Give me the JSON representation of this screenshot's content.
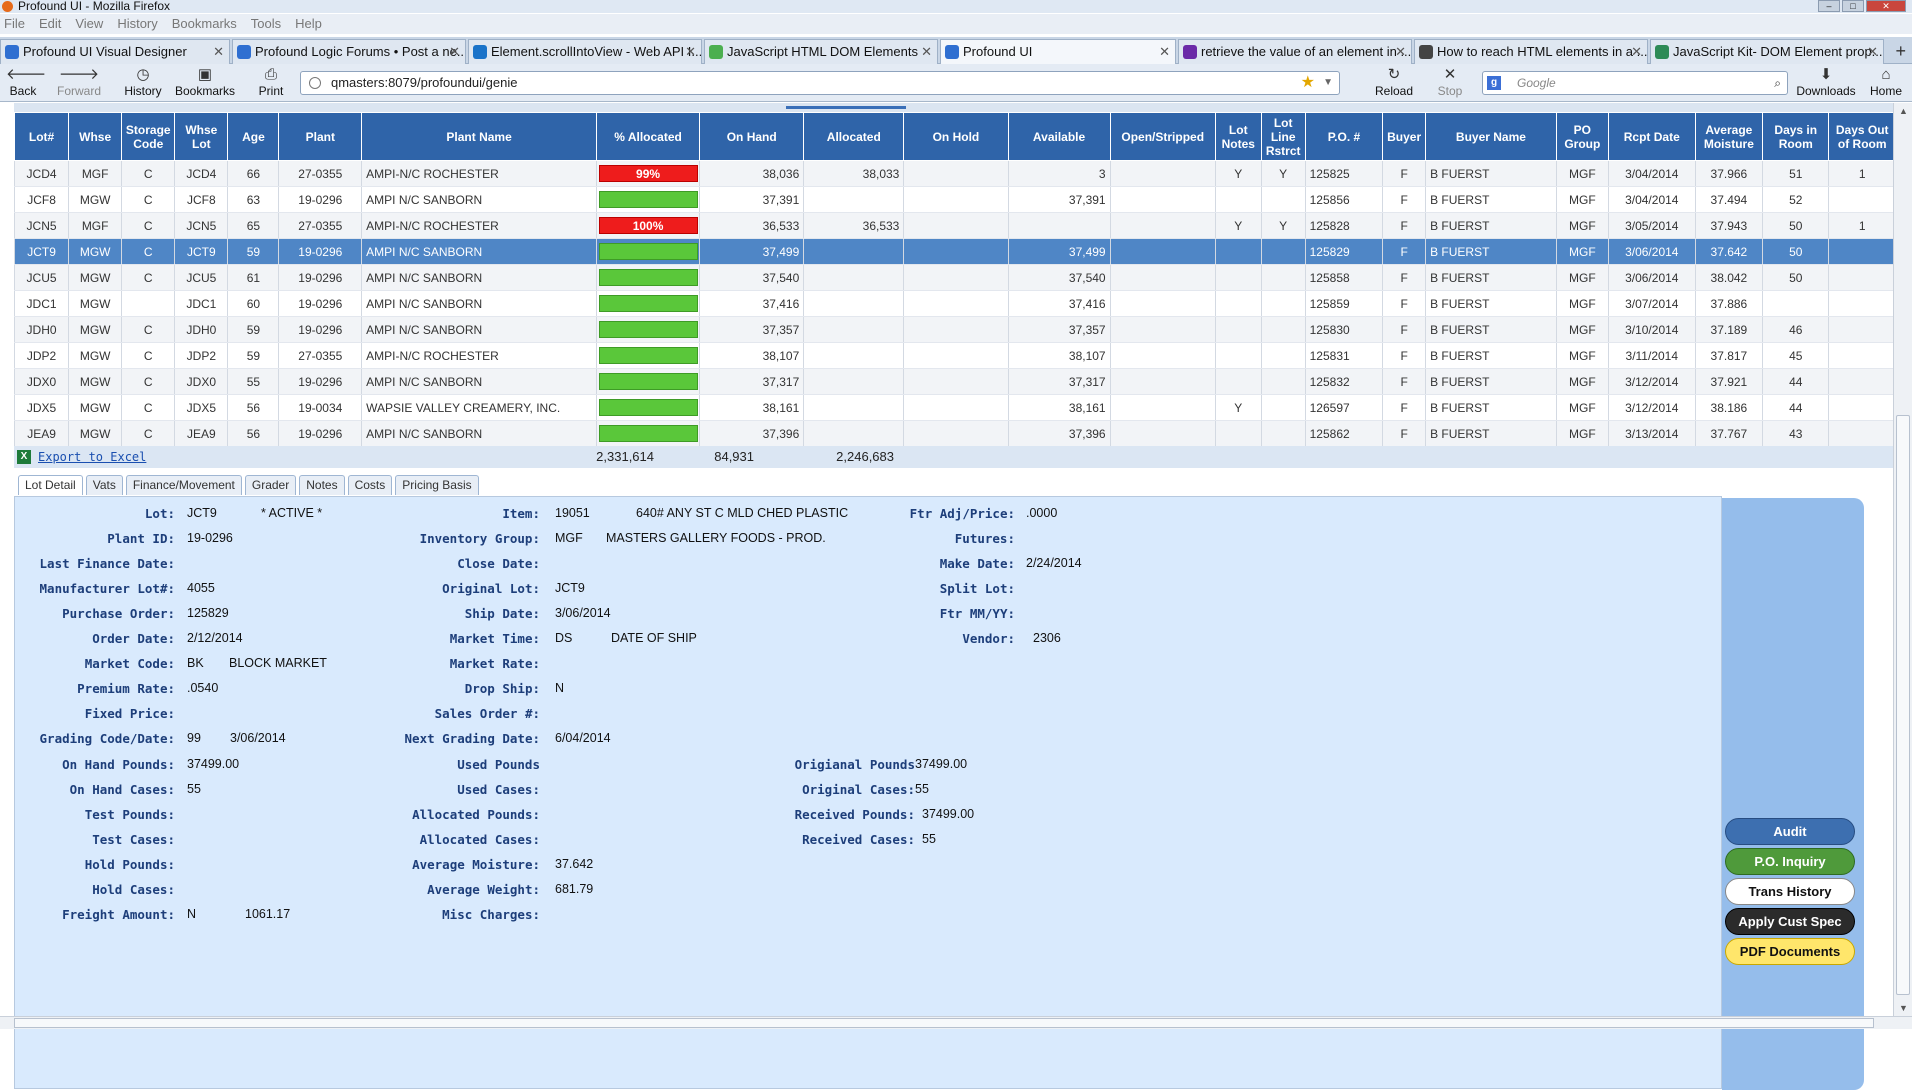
{
  "window": {
    "title": "Profound UI - Mozilla Firefox"
  },
  "menu": [
    "File",
    "Edit",
    "View",
    "History",
    "Bookmarks",
    "Tools",
    "Help"
  ],
  "tabs": [
    {
      "label": "Profound UI Visual Designer",
      "active": false,
      "icon_color": "#2f6fd1"
    },
    {
      "label": "Profound Logic Forums • Post a ne...",
      "active": false,
      "icon_color": "#2f6fd1"
    },
    {
      "label": "Element.scrollIntoView - Web API I...",
      "active": false,
      "icon_color": "#1a73c9"
    },
    {
      "label": "JavaScript HTML DOM Elements",
      "active": false,
      "icon_color": "#4caf50"
    },
    {
      "label": "Profound UI",
      "active": true,
      "icon_color": "#2f6fd1"
    },
    {
      "label": "retrieve the value of an element in ...",
      "active": false,
      "icon_color": "#6b2aa8"
    },
    {
      "label": "How to reach HTML elements in a ...",
      "active": false,
      "icon_color": "#444444"
    },
    {
      "label": "JavaScript Kit- DOM Element prop...",
      "active": false,
      "icon_color": "#2e8b57"
    }
  ],
  "nav": {
    "back": "Back",
    "forward": "Forward",
    "history": "History",
    "bookmarks": "Bookmarks",
    "print": "Print",
    "url": "qmasters:8079/profoundui/genie",
    "reload": "Reload",
    "stop": "Stop",
    "search_placeholder": "Google",
    "downloads": "Downloads",
    "home": "Home"
  },
  "grid": {
    "columns": [
      "Lot#",
      "Whse",
      "Storage Code",
      "Whse Lot",
      "Age",
      "Plant",
      "Plant Name",
      "% Allocated",
      "On Hand",
      "Allocated",
      "On Hold",
      "Available",
      "Open/Stripped",
      "Lot Notes",
      "Lot Line Rstrct",
      "P.O. #",
      "Buyer",
      "Buyer Name",
      "PO Group",
      "Rcpt Date",
      "Average Moisture",
      "Days in Room",
      "Days Out of Room"
    ],
    "rows": [
      {
        "lot": "JCD4",
        "whse": "MGF",
        "storage": "C",
        "whse_lot": "JCD4",
        "age": "66",
        "plant": "27-0355",
        "plant_name": "AMPI-N/C ROCHESTER",
        "pct_label": "99%",
        "pct": 0.99,
        "bar": "red",
        "on_hand": "38,036",
        "allocated": "38,033",
        "on_hold": "",
        "available": "3",
        "open": "",
        "notes": "Y",
        "rstrct": "Y",
        "po": "125825",
        "buyer": "F",
        "buyer_name": "B FUERST",
        "po_group": "MGF",
        "rcpt": "3/04/2014",
        "moist": "37.966",
        "days_in": "51",
        "days_out": "1"
      },
      {
        "lot": "JCF8",
        "whse": "MGW",
        "storage": "C",
        "whse_lot": "JCF8",
        "age": "63",
        "plant": "19-0296",
        "plant_name": "AMPI N/C SANBORN",
        "pct_label": "",
        "pct": 0,
        "bar": "green",
        "on_hand": "37,391",
        "allocated": "",
        "on_hold": "",
        "available": "37,391",
        "open": "",
        "notes": "",
        "rstrct": "",
        "po": "125856",
        "buyer": "F",
        "buyer_name": "B FUERST",
        "po_group": "MGF",
        "rcpt": "3/04/2014",
        "moist": "37.494",
        "days_in": "52",
        "days_out": ""
      },
      {
        "lot": "JCN5",
        "whse": "MGF",
        "storage": "C",
        "whse_lot": "JCN5",
        "age": "65",
        "plant": "27-0355",
        "plant_name": "AMPI-N/C ROCHESTER",
        "pct_label": "100%",
        "pct": 1.0,
        "bar": "red",
        "on_hand": "36,533",
        "allocated": "36,533",
        "on_hold": "",
        "available": "",
        "open": "",
        "notes": "Y",
        "rstrct": "Y",
        "po": "125828",
        "buyer": "F",
        "buyer_name": "B FUERST",
        "po_group": "MGF",
        "rcpt": "3/05/2014",
        "moist": "37.943",
        "days_in": "50",
        "days_out": "1"
      },
      {
        "lot": "JCT9",
        "whse": "MGW",
        "storage": "C",
        "whse_lot": "JCT9",
        "age": "59",
        "plant": "19-0296",
        "plant_name": "AMPI N/C SANBORN",
        "pct_label": "",
        "pct": 0,
        "bar": "green",
        "on_hand": "37,499",
        "allocated": "",
        "on_hold": "",
        "available": "37,499",
        "open": "",
        "notes": "",
        "rstrct": "",
        "po": "125829",
        "buyer": "F",
        "buyer_name": "B FUERST",
        "po_group": "MGF",
        "rcpt": "3/06/2014",
        "moist": "37.642",
        "days_in": "50",
        "days_out": "",
        "selected": true
      },
      {
        "lot": "JCU5",
        "whse": "MGW",
        "storage": "C",
        "whse_lot": "JCU5",
        "age": "61",
        "plant": "19-0296",
        "plant_name": "AMPI N/C SANBORN",
        "pct_label": "",
        "pct": 0,
        "bar": "green",
        "on_hand": "37,540",
        "allocated": "",
        "on_hold": "",
        "available": "37,540",
        "open": "",
        "notes": "",
        "rstrct": "",
        "po": "125858",
        "buyer": "F",
        "buyer_name": "B FUERST",
        "po_group": "MGF",
        "rcpt": "3/06/2014",
        "moist": "38.042",
        "days_in": "50",
        "days_out": ""
      },
      {
        "lot": "JDC1",
        "whse": "MGW",
        "storage": "",
        "whse_lot": "JDC1",
        "age": "60",
        "plant": "19-0296",
        "plant_name": "AMPI N/C SANBORN",
        "pct_label": "",
        "pct": 0,
        "bar": "green",
        "on_hand": "37,416",
        "allocated": "",
        "on_hold": "",
        "available": "37,416",
        "open": "",
        "notes": "",
        "rstrct": "",
        "po": "125859",
        "buyer": "F",
        "buyer_name": "B FUERST",
        "po_group": "MGF",
        "rcpt": "3/07/2014",
        "moist": "37.886",
        "days_in": "",
        "days_out": ""
      },
      {
        "lot": "JDH0",
        "whse": "MGW",
        "storage": "C",
        "whse_lot": "JDH0",
        "age": "59",
        "plant": "19-0296",
        "plant_name": "AMPI N/C SANBORN",
        "pct_label": "",
        "pct": 0,
        "bar": "green",
        "on_hand": "37,357",
        "allocated": "",
        "on_hold": "",
        "available": "37,357",
        "open": "",
        "notes": "",
        "rstrct": "",
        "po": "125830",
        "buyer": "F",
        "buyer_name": "B FUERST",
        "po_group": "MGF",
        "rcpt": "3/10/2014",
        "moist": "37.189",
        "days_in": "46",
        "days_out": ""
      },
      {
        "lot": "JDP2",
        "whse": "MGW",
        "storage": "C",
        "whse_lot": "JDP2",
        "age": "59",
        "plant": "27-0355",
        "plant_name": "AMPI-N/C ROCHESTER",
        "pct_label": "",
        "pct": 0,
        "bar": "green",
        "on_hand": "38,107",
        "allocated": "",
        "on_hold": "",
        "available": "38,107",
        "open": "",
        "notes": "",
        "rstrct": "",
        "po": "125831",
        "buyer": "F",
        "buyer_name": "B FUERST",
        "po_group": "MGF",
        "rcpt": "3/11/2014",
        "moist": "37.817",
        "days_in": "45",
        "days_out": ""
      },
      {
        "lot": "JDX0",
        "whse": "MGW",
        "storage": "C",
        "whse_lot": "JDX0",
        "age": "55",
        "plant": "19-0296",
        "plant_name": "AMPI N/C SANBORN",
        "pct_label": "",
        "pct": 0,
        "bar": "green",
        "on_hand": "37,317",
        "allocated": "",
        "on_hold": "",
        "available": "37,317",
        "open": "",
        "notes": "",
        "rstrct": "",
        "po": "125832",
        "buyer": "F",
        "buyer_name": "B FUERST",
        "po_group": "MGF",
        "rcpt": "3/12/2014",
        "moist": "37.921",
        "days_in": "44",
        "days_out": ""
      },
      {
        "lot": "JDX5",
        "whse": "MGW",
        "storage": "C",
        "whse_lot": "JDX5",
        "age": "56",
        "plant": "19-0034",
        "plant_name": "WAPSIE VALLEY CREAMERY, INC.",
        "pct_label": "",
        "pct": 0,
        "bar": "green",
        "on_hand": "38,161",
        "allocated": "",
        "on_hold": "",
        "available": "38,161",
        "open": "",
        "notes": "Y",
        "rstrct": "",
        "po": "126597",
        "buyer": "F",
        "buyer_name": "B FUERST",
        "po_group": "MGF",
        "rcpt": "3/12/2014",
        "moist": "38.186",
        "days_in": "44",
        "days_out": ""
      },
      {
        "lot": "JEA9",
        "whse": "MGW",
        "storage": "C",
        "whse_lot": "JEA9",
        "age": "56",
        "plant": "19-0296",
        "plant_name": "AMPI N/C SANBORN",
        "pct_label": "",
        "pct": 0,
        "bar": "green",
        "on_hand": "37,396",
        "allocated": "",
        "on_hold": "",
        "available": "37,396",
        "open": "",
        "notes": "",
        "rstrct": "",
        "po": "125862",
        "buyer": "F",
        "buyer_name": "B FUERST",
        "po_group": "MGF",
        "rcpt": "3/13/2014",
        "moist": "37.767",
        "days_in": "43",
        "days_out": ""
      }
    ],
    "export_label": "Export to Excel",
    "totals": {
      "on_hand": "2,331,614",
      "allocated": "84,931",
      "available": "2,246,683"
    }
  },
  "detail_tabs": [
    "Lot Detail",
    "Vats",
    "Finance/Movement",
    "Grader",
    "Notes",
    "Costs",
    "Pricing Basis"
  ],
  "detail": {
    "lot_lbl": "Lot:",
    "lot": "JCT9",
    "status": "* ACTIVE *",
    "plant_id_lbl": "Plant ID:",
    "plant_id": "19-0296",
    "last_fin_lbl": "Last Finance Date:",
    "mfr_lot_lbl": "Manufacturer Lot#:",
    "mfr_lot": "4055",
    "po_lbl": "Purchase Order:",
    "po": "125829",
    "order_date_lbl": "Order Date:",
    "order_date": "2/12/2014",
    "market_code_lbl": "Market Code:",
    "market_code": "BK",
    "market_desc": "BLOCK MARKET",
    "premium_lbl": "Premium Rate:",
    "premium": ".0540",
    "fixed_lbl": "Fixed Price:",
    "grading_lbl": "Grading Code/Date:",
    "grading_code": "99",
    "grading_date": "3/06/2014",
    "item_lbl": "Item:",
    "item": "19051",
    "item_desc": "640# ANY ST C MLD CHED PLASTIC",
    "inv_group_lbl": "Inventory Group:",
    "inv_group": "MGF",
    "inv_group_desc": "MASTERS GALLERY FOODS - PROD.",
    "close_lbl": "Close Date:",
    "orig_lot_lbl": "Original Lot:",
    "orig_lot": "JCT9",
    "ship_lbl": "Ship Date:",
    "ship": "3/06/2014",
    "mkt_time_lbl": "Market Time:",
    "mkt_time": "DS",
    "mkt_time_desc": "DATE OF SHIP",
    "mkt_rate_lbl": "Market Rate:",
    "drop_lbl": "Drop Ship:",
    "drop": "N",
    "sales_lbl": "Sales Order #:",
    "next_grade_lbl": "Next Grading Date:",
    "next_grade": "6/04/2014",
    "ftr_adj_lbl": "Ftr Adj/Price:",
    "ftr_adj": ".0000",
    "futures_lbl": "Futures:",
    "make_lbl": "Make Date:",
    "make": "2/24/2014",
    "split_lbl": "Split Lot:",
    "ftr_mm_lbl": "Ftr MM/YY:",
    "vendor_lbl": "Vendor:",
    "vendor": "2306",
    "on_hand_lb_lbl": "On Hand Pounds:",
    "on_hand_lb": "37499.00",
    "on_hand_cs_lbl": "On Hand Cases:",
    "on_hand_cs": "55",
    "test_lb_lbl": "Test Pounds:",
    "test_cs_lbl": "Test Cases:",
    "hold_lb_lbl": "Hold Pounds:",
    "hold_cs_lbl": "Hold Cases:",
    "freight_lbl": "Freight Amount:",
    "freight_flag": "N",
    "freight": "1061.17",
    "used_lb_lbl": "Used Pounds",
    "used_cs_lbl": "Used Cases:",
    "alloc_lb_lbl": "Allocated Pounds:",
    "alloc_cs_lbl": "Allocated Cases:",
    "avg_moist_lbl": "Average Moisture:",
    "avg_moist": "37.642",
    "avg_wt_lbl": "Average Weight:",
    "avg_wt": "681.79",
    "misc_lbl": "Misc Charges:",
    "orig_lb_lbl": "Origianal Pounds",
    "orig_lb": "37499.00",
    "orig_cs_lbl": "Original Cases:",
    "orig_cs": "55",
    "recv_lb_lbl": "Received Pounds:",
    "recv_lb": "37499.00",
    "recv_cs_lbl": "Received Cases:",
    "recv_cs": "55"
  },
  "side_buttons": {
    "audit": "Audit",
    "po_inquiry": "P.O. Inquiry",
    "trans_history": "Trans History",
    "apply_cust_spec": "Apply Cust Spec",
    "pdf_documents": "PDF Documents"
  }
}
